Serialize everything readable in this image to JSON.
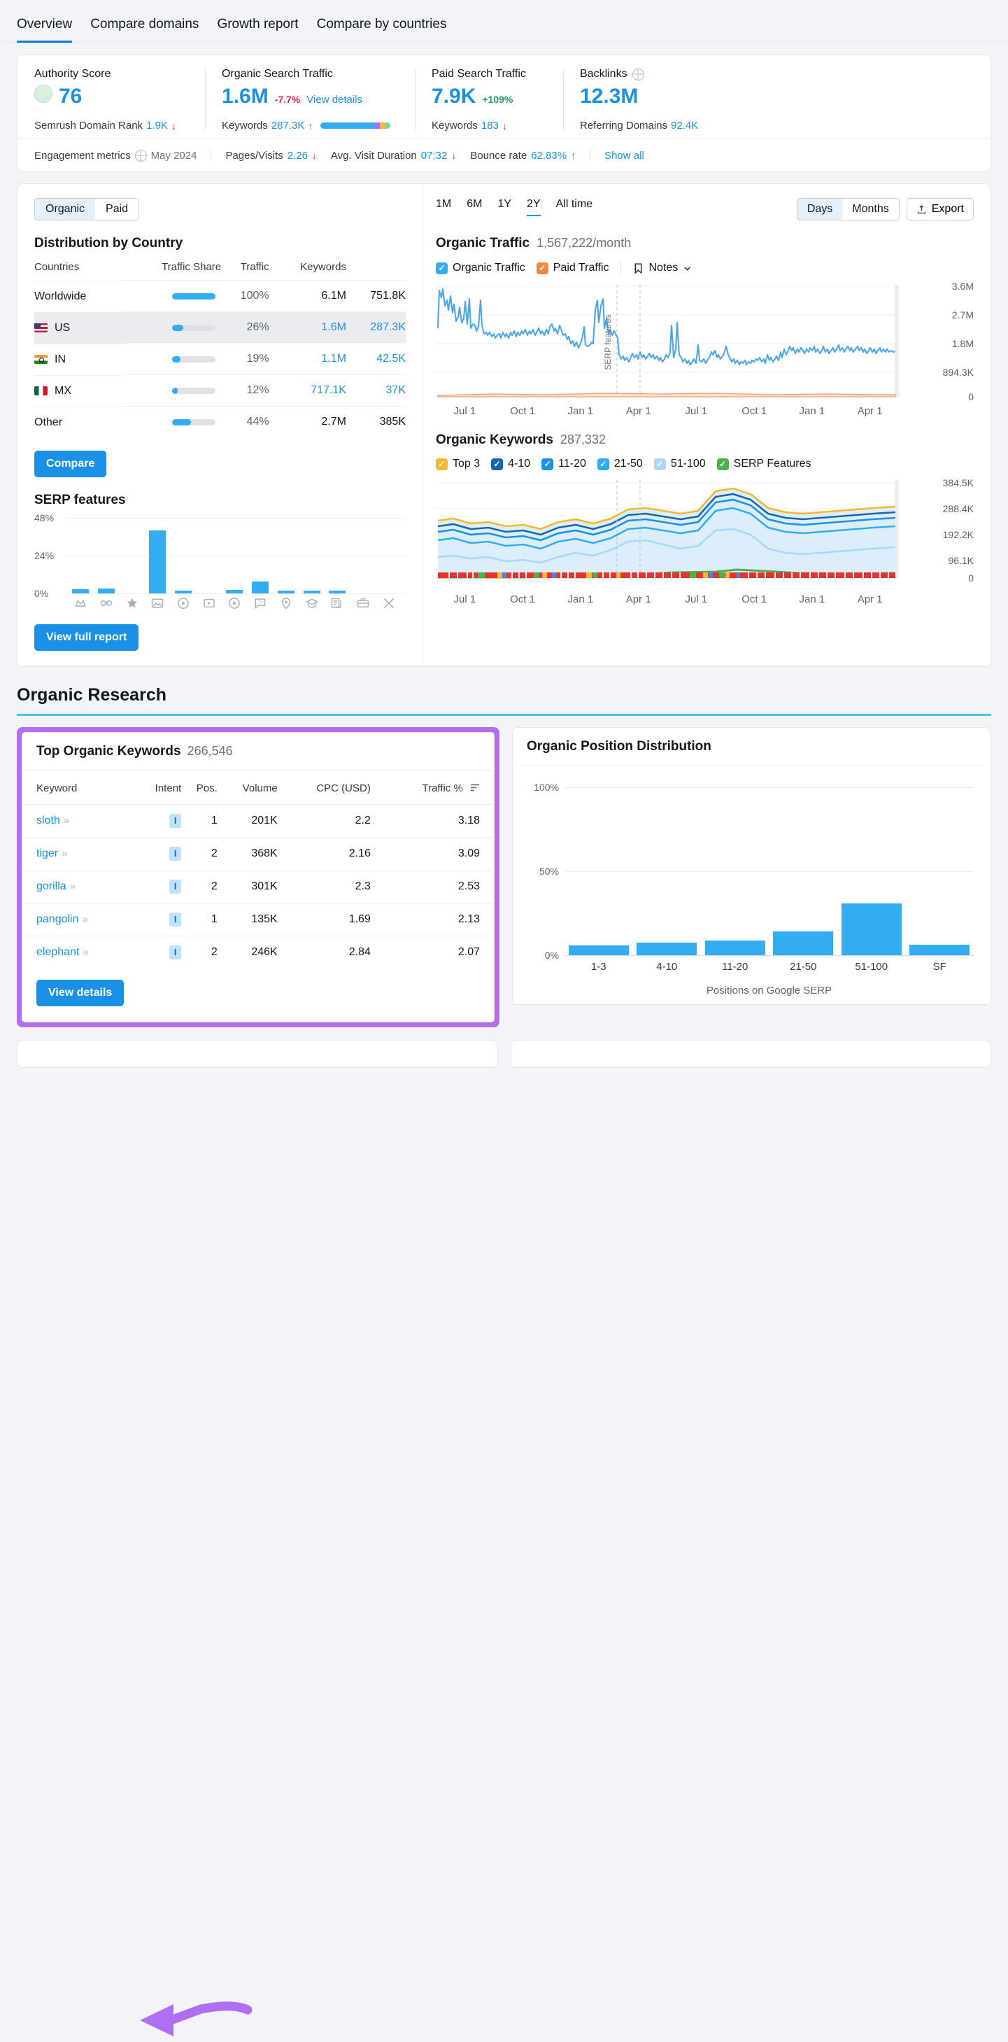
{
  "tabs": [
    {
      "label": "Overview",
      "active": true
    },
    {
      "label": "Compare domains",
      "active": false
    },
    {
      "label": "Growth report",
      "active": false
    },
    {
      "label": "Compare by countries",
      "active": false
    }
  ],
  "metrics": {
    "authority": {
      "label": "Authority Score",
      "value": "76",
      "sub_label": "Semrush Domain Rank",
      "sub_value": "1.9K",
      "sub_trend": "down"
    },
    "organic": {
      "label": "Organic Search Traffic",
      "value": "1.6M",
      "delta": "-7.7%",
      "delta_dir": "down",
      "link": "View details",
      "sub_label": "Keywords",
      "sub_value": "287.3K",
      "sub_trend": "up"
    },
    "paid": {
      "label": "Paid Search Traffic",
      "value": "7.9K",
      "delta": "+109%",
      "delta_dir": "up",
      "sub_label": "Keywords",
      "sub_value": "183",
      "sub_trend": "down"
    },
    "backlinks": {
      "label": "Backlinks",
      "value": "12.3M",
      "sub_label": "Referring Domains",
      "sub_value": "92.4K"
    }
  },
  "engagement": {
    "label": "Engagement metrics",
    "date": "May 2024",
    "items": [
      {
        "label": "Pages/Visits",
        "value": "2.26",
        "trend": "down"
      },
      {
        "label": "Avg. Visit Duration",
        "value": "07:32",
        "trend": "down"
      },
      {
        "label": "Bounce rate",
        "value": "62.83%",
        "trend": "up"
      }
    ],
    "show_all": "Show all"
  },
  "left_panel": {
    "toggle": {
      "organic": "Organic",
      "paid": "Paid",
      "selected": "Organic"
    },
    "distribution_title": "Distribution by Country",
    "columns": [
      "Countries",
      "Traffic Share",
      "Traffic",
      "Keywords"
    ],
    "rows": [
      {
        "country": "Worldwide",
        "flag": "",
        "share_pct": 100,
        "share": "100%",
        "traffic": "6.1M",
        "keywords": "751.8K",
        "highlight": false,
        "linked": false
      },
      {
        "country": "US",
        "flag": "us",
        "share_pct": 26,
        "share": "26%",
        "traffic": "1.6M",
        "keywords": "287.3K",
        "highlight": true,
        "linked": true
      },
      {
        "country": "IN",
        "flag": "in",
        "share_pct": 19,
        "share": "19%",
        "traffic": "1.1M",
        "keywords": "42.5K",
        "highlight": false,
        "linked": true
      },
      {
        "country": "MX",
        "flag": "mx",
        "share_pct": 12,
        "share": "12%",
        "traffic": "717.1K",
        "keywords": "37K",
        "highlight": false,
        "linked": true
      },
      {
        "country": "Other",
        "flag": "",
        "share_pct": 44,
        "share": "44%",
        "traffic": "2.7M",
        "keywords": "385K",
        "highlight": false,
        "linked": false
      }
    ],
    "compare_label": "Compare",
    "view_full_report_label": "View full report"
  },
  "chart_data": [
    {
      "type": "bar",
      "title": "SERP features",
      "xlabel": "",
      "ylabel": "",
      "ylim": [
        0,
        48
      ],
      "yticks": [
        "0%",
        "24%",
        "48%"
      ],
      "categories": [
        "featured-snippet",
        "sitelinks",
        "reviews",
        "image-pack",
        "video",
        "video-carousel",
        "video-preview",
        "people-also-ask",
        "local-pack",
        "knowledge-panel",
        "related-searches",
        "jobs",
        "twitter"
      ],
      "values": [
        2.5,
        3.0,
        0,
        40.0,
        1.6,
        0,
        1.8,
        7.5,
        1.5,
        1.6,
        1.7,
        0,
        0
      ]
    },
    {
      "type": "line",
      "title": "Organic Traffic",
      "subtitle": "1,567,222/month",
      "xlabel": "",
      "ylabel": "",
      "ylim": [
        0,
        3600000
      ],
      "yticks": [
        "3.6M",
        "2.7M",
        "1.8M",
        "894.3K",
        "0"
      ],
      "xticks": [
        "Jul 1",
        "Oct 1",
        "Jan 1",
        "Apr 1",
        "Jul 1",
        "Oct 1",
        "Jan 1",
        "Apr 1"
      ],
      "annotation": "SERP features",
      "series": [
        {
          "name": "Organic Traffic",
          "color": "#4da6e8"
        },
        {
          "name": "Paid Traffic",
          "color": "#f0a070"
        }
      ]
    },
    {
      "type": "area",
      "title": "Organic Keywords",
      "subtitle": "287,332",
      "xlabel": "",
      "ylabel": "",
      "ylim": [
        0,
        384500
      ],
      "yticks": [
        "384.5K",
        "288.4K",
        "192.2K",
        "96.1K",
        "0"
      ],
      "xticks": [
        "Jul 1",
        "Oct 1",
        "Jan 1",
        "Apr 1",
        "Jul 1",
        "Oct 1",
        "Jan 1",
        "Apr 1"
      ],
      "series": [
        {
          "name": "Top 3",
          "color": "#f7b733"
        },
        {
          "name": "4-10",
          "color": "#1568ad"
        },
        {
          "name": "11-20",
          "color": "#1a91e6"
        },
        {
          "name": "21-50",
          "color": "#32adf2"
        },
        {
          "name": "51-100",
          "color": "#a9d9f7"
        },
        {
          "name": "SERP Features",
          "color": "#4caf50"
        }
      ]
    },
    {
      "type": "bar",
      "title": "Organic Position Distribution",
      "xlabel": "Positions on Google SERP",
      "ylabel": "",
      "ylim": [
        0,
        100
      ],
      "yticks": [
        "0%",
        "50%",
        "100%"
      ],
      "categories": [
        "1-3",
        "4-10",
        "11-20",
        "21-50",
        "51-100",
        "SF"
      ],
      "values": [
        5.5,
        7.5,
        8.5,
        14.0,
        30.5,
        6.0
      ]
    }
  ],
  "right_panel": {
    "ranges": [
      {
        "label": "1M",
        "active": false
      },
      {
        "label": "6M",
        "active": false
      },
      {
        "label": "1Y",
        "active": false
      },
      {
        "label": "2Y",
        "active": true
      },
      {
        "label": "All time",
        "active": false
      }
    ],
    "granularity": {
      "days": "Days",
      "months": "Months",
      "selected": "Days"
    },
    "export_label": "Export",
    "traffic_title": "Organic Traffic",
    "traffic_value": "1,567,222/month",
    "traffic_legend": [
      {
        "label": "Organic Traffic",
        "color": "#32adf2",
        "checked": true
      },
      {
        "label": "Paid Traffic",
        "color": "#f0873e",
        "checked": true
      }
    ],
    "notes_label": "Notes",
    "keywords_title": "Organic Keywords",
    "keywords_value": "287,332",
    "keywords_legend": [
      {
        "label": "Top 3",
        "color": "#f7b733",
        "checked": true
      },
      {
        "label": "4-10",
        "color": "#1568ad",
        "checked": true
      },
      {
        "label": "11-20",
        "color": "#1a91e6",
        "checked": true
      },
      {
        "label": "21-50",
        "color": "#32adf2",
        "checked": true
      },
      {
        "label": "51-100",
        "color": "#a9d9f7",
        "checked": true
      },
      {
        "label": "SERP Features",
        "color": "#4caf50",
        "checked": true
      }
    ],
    "serp_annotation": "SERP features"
  },
  "organic_research": {
    "section_title": "Organic Research",
    "keywords_card": {
      "title": "Top Organic Keywords",
      "count": "266,546",
      "columns": [
        "Keyword",
        "Intent",
        "Pos.",
        "Volume",
        "CPC (USD)",
        "Traffic %"
      ],
      "rows": [
        {
          "keyword": "sloth",
          "intent": "I",
          "pos": "1",
          "volume": "201K",
          "cpc": "2.2",
          "traffic": "3.18"
        },
        {
          "keyword": "tiger",
          "intent": "I",
          "pos": "2",
          "volume": "368K",
          "cpc": "2.16",
          "traffic": "3.09"
        },
        {
          "keyword": "gorilla",
          "intent": "I",
          "pos": "2",
          "volume": "301K",
          "cpc": "2.3",
          "traffic": "2.53"
        },
        {
          "keyword": "pangolin",
          "intent": "I",
          "pos": "1",
          "volume": "135K",
          "cpc": "1.69",
          "traffic": "2.13"
        },
        {
          "keyword": "elephant",
          "intent": "I",
          "pos": "2",
          "volume": "246K",
          "cpc": "2.84",
          "traffic": "2.07"
        }
      ],
      "view_details_label": "View details"
    },
    "position_card": {
      "title": "Organic Position Distribution",
      "caption": "Positions on Google SERP"
    }
  },
  "colors": {
    "accent": "#1a91e6",
    "highlight_purple": "#b06ff0",
    "positive": "#1f9e5c",
    "negative": "#e5254d"
  }
}
